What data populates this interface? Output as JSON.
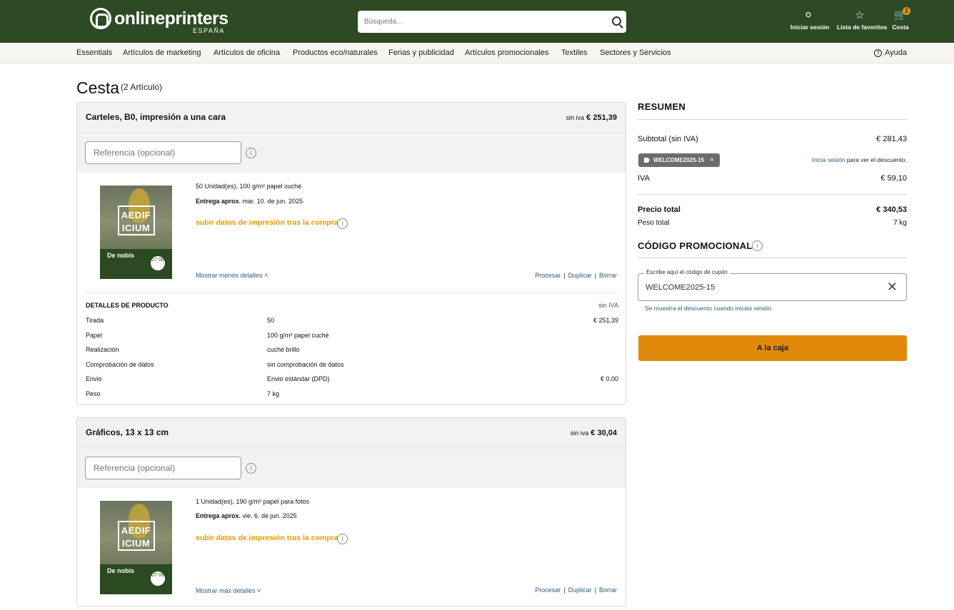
{
  "header": {
    "logo_text": "onlineprinters",
    "logo_sub": "ESPAÑA",
    "search_placeholder": "Búsqueda...",
    "login_label": "Iniciar sesión",
    "favorites_label": "Lista de favoritos",
    "cart_label": "Cesta",
    "cart_count": "2"
  },
  "nav": {
    "items": [
      "Essentials",
      "Artículos de marketing",
      "Artículos de oficina",
      "Productos eco/naturales",
      "Ferias y publicidad",
      "Artículos promocionales",
      "Textiles",
      "Sectores y Servicios"
    ],
    "help": "Ayuda"
  },
  "page": {
    "title": "Cesta",
    "count": "(2 Artículo)"
  },
  "thumb": {
    "title_line1": "AEDIF",
    "title_line2": "ICIUM",
    "subtitle": "De nobis",
    "date": "07 06"
  },
  "cart": [
    {
      "title": "Carteles, B0, impresión a una cara",
      "price_prefix": "sin iva",
      "price": "€ 251,39",
      "ref_placeholder": "Referencia (opcional)",
      "spec_line": "50 Unidad(es), 100 g/m² papel cuché",
      "delivery_label": "Entrega aprox.",
      "delivery_date": "mar. 10. de jun. 2025",
      "upload_label": "subir datos de impresión tras la compra",
      "toggle_label": "Mostrar menos detalles",
      "actions": [
        "Procesar",
        "Duplicar",
        "Borrar"
      ],
      "details": {
        "heading": "DETALLES DE PRODUCTO",
        "tax_note": "sin IVA",
        "rows": [
          {
            "label": "Tirada",
            "value": "50",
            "price": "€ 251,39"
          },
          {
            "label": "Papel",
            "value": "100 g/m² papel cuché",
            "price": ""
          },
          {
            "label": "Realización",
            "value": "cuché brillo",
            "price": ""
          },
          {
            "label": "Comprobación de datos",
            "value": "sin comprobación de datos",
            "price": ""
          },
          {
            "label": "Envio",
            "value": "Envio estándar (DPD)",
            "price": "€ 0,00"
          },
          {
            "label": "Peso",
            "value": "7 kg",
            "price": ""
          }
        ]
      }
    },
    {
      "title": "Gráficos, 13 x 13 cm",
      "price_prefix": "sin iva",
      "price": "€ 30,04",
      "ref_placeholder": "Referencia (opcional)",
      "spec_line": "1 Unidad(es), 190 g/m² papel para fotos",
      "delivery_label": "Entrega aprox.",
      "delivery_date": "vie. 6. de jun. 2025",
      "upload_label": "subir datos de impresión tras la compra",
      "toggle_label": "Mostrar más detalles",
      "actions": [
        "Procesar",
        "Duplicar",
        "Borrar"
      ]
    }
  ],
  "summary": {
    "title": "RESUMEN",
    "subtotal_label": "Subtotal (sin IVA)",
    "subtotal_value": "€ 281,43",
    "coupon_code": "WELCOME2025-15",
    "login_link": "Inicia sesión",
    "login_note": "para ver el descuento.",
    "iva_label": "IVA",
    "iva_value": "€ 59,10",
    "total_label": "Precio total",
    "total_value": "€ 340,53",
    "weight_label": "Peso total",
    "weight_value": "7 kg",
    "promo_title": "CÓDIGO PROMOCIONAL",
    "promo_input_label": "Escribe aquí el código de cupón",
    "promo_input_value": "WELCOME2025-15",
    "promo_note": "Se muestra el descuento cuando inicias sesión.",
    "checkout_label": "A la caja"
  },
  "colors": {
    "header_bg": "#2d4a24",
    "accent_orange": "#e0890a",
    "link_blue": "#2c5c7a"
  }
}
